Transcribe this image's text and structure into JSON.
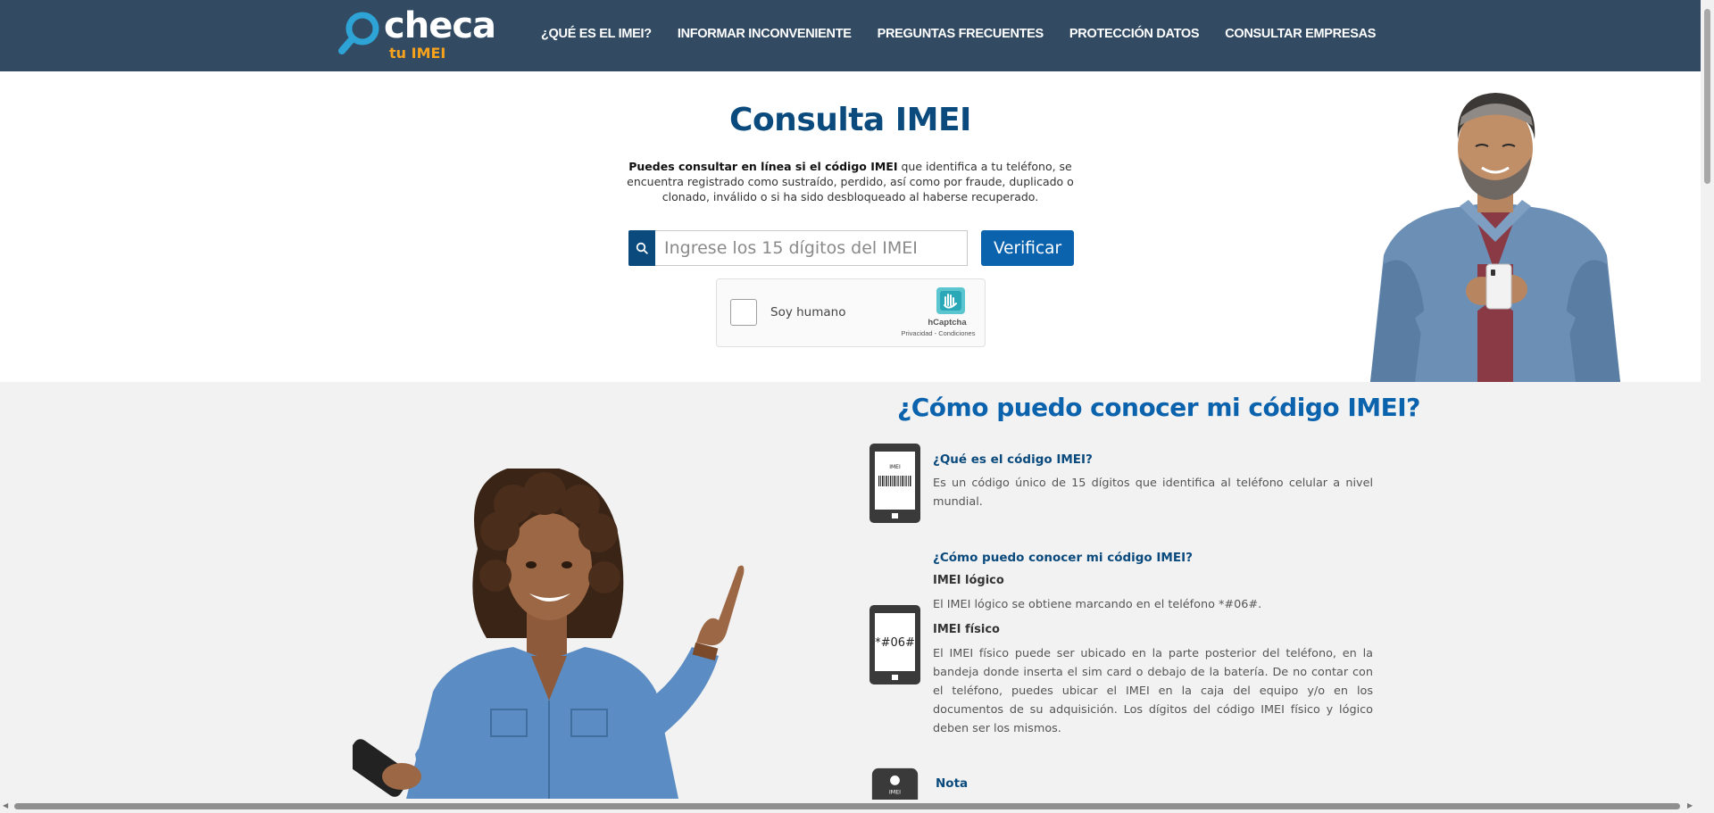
{
  "header": {
    "logo": {
      "word": "checa",
      "sub": "tu IMEI"
    },
    "nav": [
      {
        "label": "¿QUÉ ES EL IMEI?"
      },
      {
        "label": "INFORMAR INCONVENIENTE"
      },
      {
        "label": "PREGUNTAS FRECUENTES"
      },
      {
        "label": "PROTECCIÓN DATOS"
      },
      {
        "label": "CONSULTAR EMPRESAS"
      }
    ],
    "bg_color": "#324b63",
    "logo_accent": "#2ea3d6",
    "logo_sub_color": "#f6a21d"
  },
  "hero": {
    "title": "Consulta IMEI",
    "desc_bold": "Puedes consultar en línea si el código IMEI",
    "desc_rest": " que identifica a tu teléfono, se encuentra registrado como sustraído, perdido, así como por fraude, duplicado o clonado, inválido o si ha sido desbloqueado al haberse recuperado.",
    "search_placeholder": "Ingrese los 15 dígitos del IMEI",
    "search_icon": "search-icon",
    "verify_label": "Verificar",
    "captcha": {
      "label": "Soy humano",
      "brand": "hCaptcha",
      "links": "Privacidad - Condiciones"
    }
  },
  "section": {
    "title": "¿Cómo puedo conocer mi código IMEI?",
    "items": [
      {
        "icon": "phone-barcode-icon",
        "icon_text": "IMEI",
        "heading": "¿Qué es el código IMEI?",
        "text": "Es un código único de 15 dígitos que identifica al teléfono celular a nivel mundial."
      },
      {
        "icon": "phone-dial-code-icon",
        "icon_text": "*#06#",
        "heading": "¿Cómo puedo conocer mi código IMEI?",
        "sub1": "IMEI lógico",
        "text1": "El IMEI lógico se obtiene marcando en el teléfono *#06#.",
        "sub2": "IMEI físico",
        "text2": "El IMEI físico puede ser ubicado en la parte posterior del teléfono, en la bandeja donde inserta el sim card o debajo de la batería. De no contar con el teléfono, puedes ubicar el IMEI en la caja del equipo y/o en los documentos de su adquisición. Los dígitos del código IMEI físico y lógico deben ser los mismos."
      },
      {
        "icon": "phone-battery-icon",
        "icon_text": "IMEI",
        "heading": "Nota"
      }
    ]
  },
  "colors": {
    "primary": "#0b62ad",
    "dark_blue": "#0a4a7d",
    "section_bg": "#f2f2f2"
  }
}
